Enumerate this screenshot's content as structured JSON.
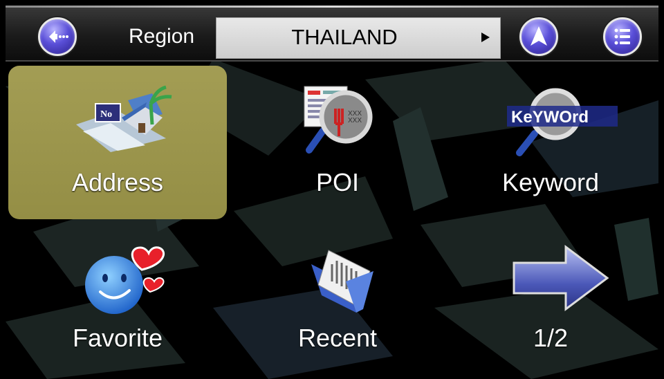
{
  "header": {
    "region_label": "Region",
    "region_value": "THAILAND"
  },
  "icons": {
    "back": "back-icon",
    "navigate": "navigate-arrow-icon",
    "menu": "menu-list-icon"
  },
  "tiles": [
    {
      "label": "Address",
      "selected": true,
      "icon": "address-house-icon",
      "sign_text": "No"
    },
    {
      "label": "POI",
      "selected": false,
      "icon": "poi-magnifier-icon",
      "icon_text": "XXX"
    },
    {
      "label": "Keyword",
      "selected": false,
      "icon": "keyword-magnifier-icon",
      "icon_text": "KeYWOrd"
    },
    {
      "label": "Favorite",
      "selected": false,
      "icon": "favorite-smiley-heart-icon"
    },
    {
      "label": "Recent",
      "selected": false,
      "icon": "recent-folder-icon"
    },
    {
      "label": "1/2",
      "selected": false,
      "icon": "next-page-arrow-icon"
    }
  ],
  "colors": {
    "selected_tile": "#9d9750",
    "button_blue": "#5a4fd8",
    "region_box": "#d8d8d8"
  }
}
